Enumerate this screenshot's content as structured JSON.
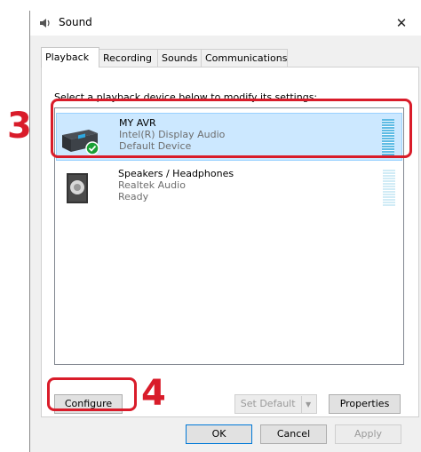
{
  "window": {
    "title": "Sound",
    "tabs": [
      "Playback",
      "Recording",
      "Sounds",
      "Communications"
    ],
    "active_tab": "Playback"
  },
  "panel": {
    "instruction": "Select a playback device below to modify its settings:"
  },
  "devices": [
    {
      "name": "MY AVR",
      "line2": "Intel(R) Display Audio",
      "line3": "Default Device",
      "icon": "avr-receiver-icon",
      "selected": true
    },
    {
      "name": "Speakers / Headphones",
      "line2": "Realtek Audio",
      "line3": "Ready",
      "icon": "speaker-icon",
      "selected": false
    }
  ],
  "buttons": {
    "configure": "Configure",
    "set_default": "Set Default",
    "properties": "Properties",
    "ok": "OK",
    "cancel": "Cancel",
    "apply": "Apply"
  },
  "annotations": {
    "step_device": "3",
    "step_configure": "4",
    "color": "#d91c2a"
  },
  "colors": {
    "selection": "#cce8ff",
    "check": "#1aa035"
  }
}
